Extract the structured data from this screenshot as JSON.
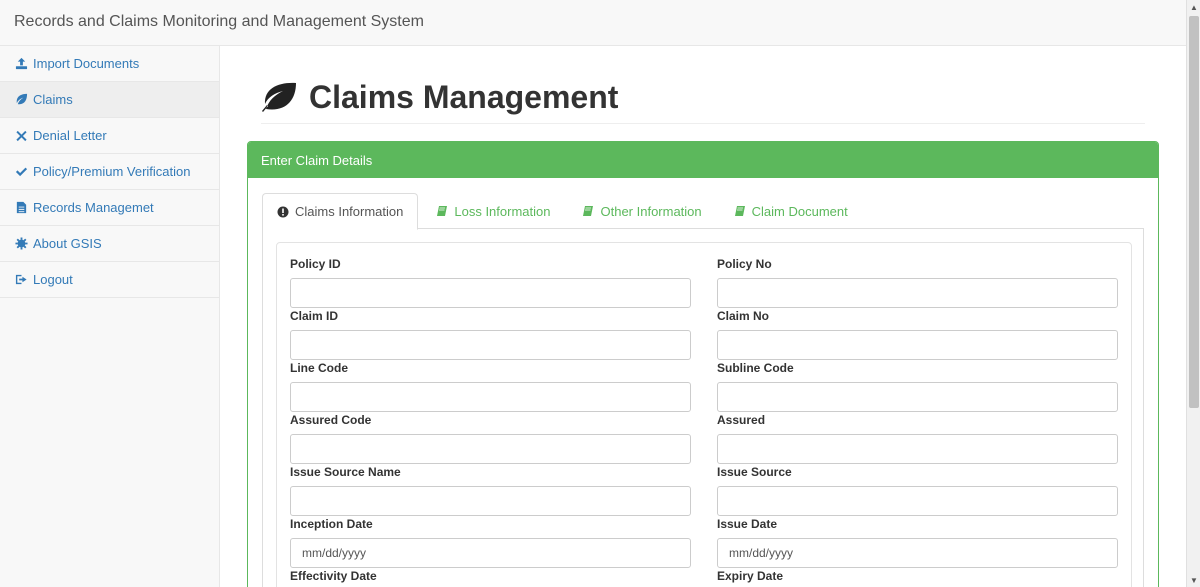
{
  "app": {
    "title": "Records and Claims Monitoring and Management System"
  },
  "sidebar": {
    "items": [
      {
        "label": "Import Documents",
        "icon": "upload-icon"
      },
      {
        "label": "Claims",
        "icon": "leaf-icon"
      },
      {
        "label": "Denial Letter",
        "icon": "close-icon"
      },
      {
        "label": "Policy/Premium Verification",
        "icon": "check-icon"
      },
      {
        "label": "Records Managemet",
        "icon": "document-icon"
      },
      {
        "label": "About GSIS",
        "icon": "gear-icon"
      },
      {
        "label": "Logout",
        "icon": "logout-icon"
      }
    ]
  },
  "page": {
    "title": "Claims Management"
  },
  "panel": {
    "heading": "Enter Claim Details"
  },
  "tabs": [
    {
      "label": "Claims Information",
      "icon": "exclamation-circle-icon"
    },
    {
      "label": "Loss Information",
      "icon": "book-icon"
    },
    {
      "label": "Other Information",
      "icon": "book-icon"
    },
    {
      "label": "Claim Document",
      "icon": "book-icon"
    }
  ],
  "form": {
    "policy_id": {
      "label": "Policy ID",
      "value": ""
    },
    "policy_no": {
      "label": "Policy No",
      "value": ""
    },
    "claim_id": {
      "label": "Claim ID",
      "value": ""
    },
    "claim_no": {
      "label": "Claim No",
      "value": ""
    },
    "line_code": {
      "label": "Line Code",
      "value": ""
    },
    "subline_code": {
      "label": "Subline Code",
      "value": ""
    },
    "assured_code": {
      "label": "Assured Code",
      "value": ""
    },
    "assured": {
      "label": "Assured",
      "value": ""
    },
    "issue_source_name": {
      "label": "Issue Source Name",
      "value": ""
    },
    "issue_source": {
      "label": "Issue Source",
      "value": ""
    },
    "inception_date": {
      "label": "Inception Date",
      "placeholder": "mm/dd/yyyy"
    },
    "issue_date": {
      "label": "Issue Date",
      "placeholder": "mm/dd/yyyy"
    },
    "effectivity_date": {
      "label": "Effectivity Date"
    },
    "expiry_date": {
      "label": "Expiry Date"
    }
  },
  "colors": {
    "accent": "#5cb85c",
    "link": "#337ab7"
  }
}
